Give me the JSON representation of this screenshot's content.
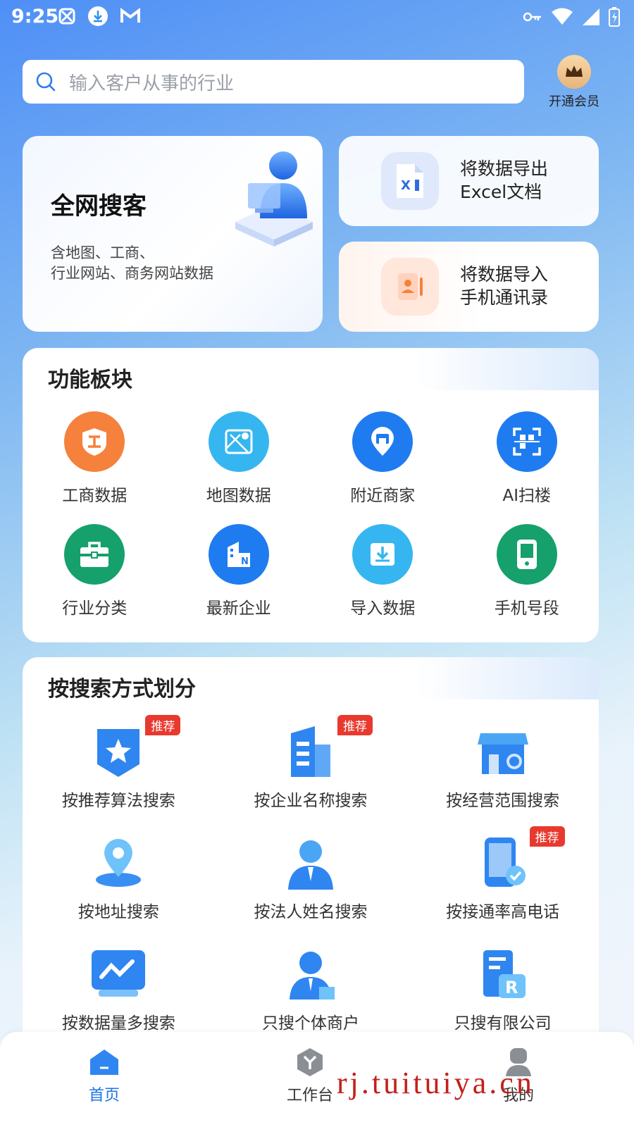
{
  "status_bar": {
    "time": "9:25",
    "left_icons": [
      "grid-icon",
      "download-icon",
      "gmail-icon"
    ],
    "right_icons": [
      "key-icon",
      "wifi-icon",
      "signal-icon",
      "battery-icon"
    ]
  },
  "search": {
    "placeholder": "输入客户从事的行业"
  },
  "vip": {
    "label": "开通会员",
    "icon": "crown-icon"
  },
  "main_card": {
    "title": "全网搜客",
    "desc_line1": "含地图、工商、",
    "desc_line2": "行业网站、商务网站数据"
  },
  "export_card": {
    "line1": "将数据导出",
    "line2": "Excel文档"
  },
  "import_card": {
    "line1": "将数据导入",
    "line2": "手机通讯录"
  },
  "function_panel": {
    "title": "功能板块",
    "items": [
      {
        "label": "工商数据",
        "icon": "business-icon",
        "color": "#f5813c"
      },
      {
        "label": "地图数据",
        "icon": "map-icon",
        "color": "#35b6f0"
      },
      {
        "label": "附近商家",
        "icon": "nearby-shop-icon",
        "color": "#1f7cf0"
      },
      {
        "label": "AI扫楼",
        "icon": "scan-icon",
        "color": "#1f7cf0"
      },
      {
        "label": "行业分类",
        "icon": "briefcase-icon",
        "color": "#16a06c"
      },
      {
        "label": "最新企业",
        "icon": "building-icon",
        "color": "#1f7cf0"
      },
      {
        "label": "导入数据",
        "icon": "import-icon",
        "color": "#35b6f0"
      },
      {
        "label": "手机号段",
        "icon": "phone-icon",
        "color": "#16a06c"
      }
    ]
  },
  "search_panel": {
    "title": "按搜索方式划分",
    "badge_text": "推荐",
    "items": [
      {
        "label": "按推荐算法搜索",
        "icon": "star-shield-icon",
        "badge": true
      },
      {
        "label": "按企业名称搜索",
        "icon": "office-building-icon",
        "badge": true
      },
      {
        "label": "按经营范围搜索",
        "icon": "storefront-icon",
        "badge": false
      },
      {
        "label": "按地址搜索",
        "icon": "location-pin-icon",
        "badge": false
      },
      {
        "label": "按法人姓名搜索",
        "icon": "person-icon",
        "badge": false
      },
      {
        "label": "按接通率高电话",
        "icon": "phone-check-icon",
        "badge": true
      },
      {
        "label": "按数据量多搜索",
        "icon": "chart-screen-icon",
        "badge": false
      },
      {
        "label": "只搜个体商户",
        "icon": "merchant-icon",
        "badge": false
      },
      {
        "label": "只搜有限公司",
        "icon": "registered-company-icon",
        "badge": false
      }
    ]
  },
  "tabbar": {
    "items": [
      {
        "label": "首页",
        "icon": "home-icon",
        "active": true
      },
      {
        "label": "工作台",
        "icon": "workbench-icon",
        "active": false
      },
      {
        "label": "我的",
        "icon": "profile-icon",
        "active": false
      }
    ]
  },
  "watermark": "rj.tuituiya.cn",
  "colors": {
    "accent": "#1a73e8",
    "badge": "#e8392f"
  }
}
